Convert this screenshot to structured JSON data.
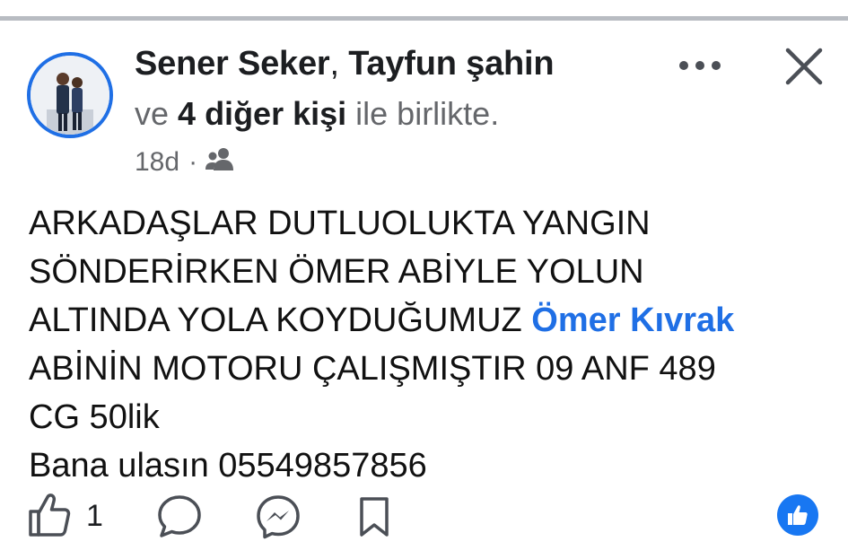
{
  "post": {
    "author_primary": "Sener Seker",
    "separator": ",",
    "author_secondary": "Tayfun şahin",
    "with_prefix": "ve",
    "with_others": "4 diğer kişi",
    "with_suffix": "ile birlikte.",
    "timestamp": "18d",
    "meta_dot": "·",
    "audience_icon": "friends-icon",
    "body_lines": {
      "l1": "ARKADAŞLAR DUTLUOLUKTA YANGIN",
      "l2": "SÖNDERİRKEN ÖMER ABİYLE YOLUN",
      "l3_text": "ALTINDA YOLA KOYDUĞUMUZ ",
      "l3_mention": "Ömer Kıvrak",
      "l4": "ABİNİN MOTORU ÇALIŞMIŞTIR 09 ANF 489",
      "l5": "CG 50lik",
      "l6": "Bana ulasın 05549857856"
    },
    "like_count": "1"
  },
  "colors": {
    "accent": "#1877f2",
    "mention": "#1f6fe5",
    "muted_text": "#65676b",
    "divider": "#b8bcc2"
  },
  "icons": [
    "more-options-icon",
    "close-icon",
    "like-icon",
    "comment-icon",
    "messenger-icon",
    "save-icon",
    "like-reaction-icon"
  ]
}
